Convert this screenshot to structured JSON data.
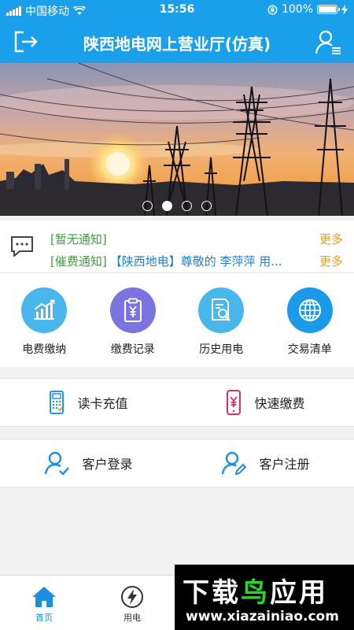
{
  "status": {
    "carrier": "中国移动",
    "time": "15:56",
    "battery": "100%"
  },
  "navbar": {
    "title": "陕西地电网上营业厅(仿真)"
  },
  "banner": {
    "slides": 4,
    "active_index": 1
  },
  "notices": [
    {
      "tag": "[暂无通知]",
      "text": "",
      "more": "更多"
    },
    {
      "tag": "[催费通知]",
      "text": "【陕西地电】尊敬的 李萍萍 用...",
      "more": "更多"
    }
  ],
  "grid": [
    {
      "label": "电费缴纳",
      "icon": "chart-up-icon",
      "color": "#49b6ec"
    },
    {
      "label": "缴费记录",
      "icon": "receipt-yen-icon",
      "color": "#7a73e0"
    },
    {
      "label": "历史用电",
      "icon": "document-search-icon",
      "color": "#49b6ec"
    },
    {
      "label": "交易清单",
      "icon": "globe-icon",
      "color": "#1a9ae8"
    }
  ],
  "rows": [
    {
      "left": "读卡充值",
      "right": "快速缴费"
    },
    {
      "left": "客户登录",
      "right": "客户注册"
    }
  ],
  "tabbar": {
    "tabs": [
      "首页",
      "用电"
    ]
  },
  "watermark": {
    "title_a": "下载",
    "title_b": "鸟",
    "title_c": "应用",
    "url": "www.xiazainiao.com"
  }
}
